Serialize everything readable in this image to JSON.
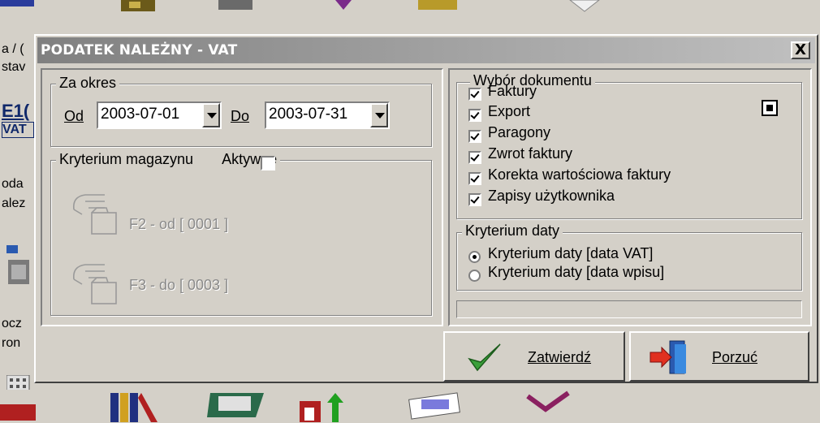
{
  "background": {
    "left_fragments": [
      "a / (",
      "stav",
      "E1(",
      "VAT",
      "oda",
      "alez",
      "ocz",
      "ron"
    ]
  },
  "dialog": {
    "title": "PODATEK NALEŻNY - VAT",
    "close_label": "X",
    "period": {
      "legend": "Za okres",
      "from_label": "Od",
      "from_value": "2003-07-01",
      "to_label": "Do",
      "to_value": "2003-07-31"
    },
    "warehouse": {
      "legend": "Kryterium magazynu",
      "active_label": "Aktywne",
      "active_checked": false,
      "from_label": "F2 - od [ 0001 ]",
      "to_label": "F3 - do [ 0003 ]"
    },
    "documents": {
      "legend": "Wybór dokumentu",
      "items": [
        {
          "label": "Faktury",
          "checked": true
        },
        {
          "label": "Export",
          "checked": true
        },
        {
          "label": "Paragony",
          "checked": true
        },
        {
          "label": "Zwrot faktury",
          "checked": true
        },
        {
          "label": "Korekta wartościowa faktury",
          "checked": true
        },
        {
          "label": "Zapisy użytkownika",
          "checked": true
        }
      ]
    },
    "date_criteria": {
      "legend": "Kryterium daty",
      "options": [
        {
          "label": "Kryterium daty [data VAT]",
          "selected": true
        },
        {
          "label": "Kryterium daty [data wpisu]",
          "selected": false
        }
      ]
    },
    "buttons": {
      "confirm": "Zatwierdź",
      "cancel": "Porzuć"
    }
  }
}
